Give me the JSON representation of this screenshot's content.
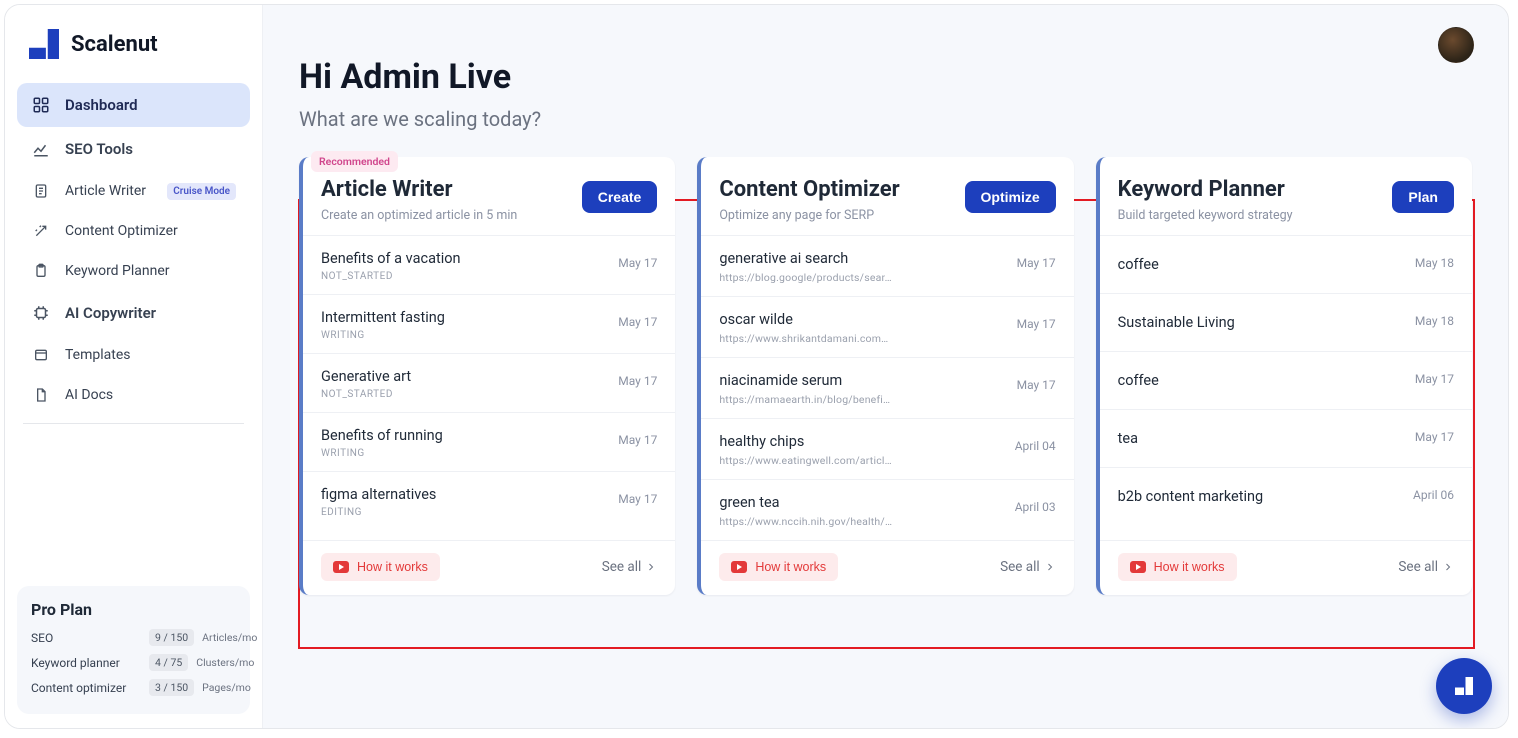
{
  "brand": {
    "name": "Scalenut"
  },
  "sidebar": {
    "items": [
      {
        "label": "Dashboard"
      },
      {
        "label": "SEO Tools"
      },
      {
        "label": "Article Writer",
        "badge": "Cruise Mode"
      },
      {
        "label": "Content Optimizer"
      },
      {
        "label": "Keyword Planner"
      },
      {
        "label": "AI Copywriter"
      },
      {
        "label": "Templates"
      },
      {
        "label": "AI Docs"
      }
    ],
    "plan": {
      "title": "Pro Plan",
      "rows": [
        {
          "label": "SEO",
          "used": "9 / 150",
          "unit": "Articles/mo"
        },
        {
          "label": "Keyword planner",
          "used": "4 / 75",
          "unit": "Clusters/mo"
        },
        {
          "label": "Content optimizer",
          "used": "3 / 150",
          "unit": "Pages/mo"
        }
      ]
    }
  },
  "header": {
    "greeting": "Hi Admin Live",
    "subtitle": "What are we scaling today?"
  },
  "cards": [
    {
      "recommended": "Recommended",
      "title": "Article Writer",
      "desc": "Create an optimized article in 5 min",
      "action": "Create",
      "items": [
        {
          "title": "Benefits of a vacation",
          "sub": "NOT_STARTED",
          "date": "May 17",
          "status": true
        },
        {
          "title": "Intermittent fasting",
          "sub": "WRITING",
          "date": "May 17",
          "status": true
        },
        {
          "title": "Generative art",
          "sub": "NOT_STARTED",
          "date": "May 17",
          "status": true
        },
        {
          "title": "Benefits of running",
          "sub": "WRITING",
          "date": "May 17",
          "status": true
        },
        {
          "title": "figma alternatives",
          "sub": "EDITING",
          "date": "May 17",
          "status": true
        }
      ],
      "how": "How it works",
      "seeall": "See all"
    },
    {
      "title": "Content Optimizer",
      "desc": "Optimize any page for SERP",
      "action": "Optimize",
      "items": [
        {
          "title": "generative ai search",
          "sub": "https://blog.google/products/sear…",
          "date": "May 17"
        },
        {
          "title": "oscar wilde",
          "sub": "https://www.shrikantdamani.com…",
          "date": "May 17"
        },
        {
          "title": "niacinamide serum",
          "sub": "https://mamaearth.in/blog/benefi…",
          "date": "May 17"
        },
        {
          "title": "healthy chips",
          "sub": "https://www.eatingwell.com/articl…",
          "date": "April 04"
        },
        {
          "title": "green tea",
          "sub": "https://www.nccih.nih.gov/health/…",
          "date": "April 03"
        }
      ],
      "how": "How it works",
      "seeall": "See all"
    },
    {
      "title": "Keyword Planner",
      "desc": "Build targeted keyword strategy",
      "action": "Plan",
      "items": [
        {
          "title": "coffee",
          "date": "May 18"
        },
        {
          "title": "Sustainable Living",
          "date": "May 18"
        },
        {
          "title": "coffee",
          "date": "May 17"
        },
        {
          "title": "tea",
          "date": "May 17"
        },
        {
          "title": "b2b content marketing",
          "date": "April 06"
        }
      ],
      "how": "How it works",
      "seeall": "See all"
    }
  ]
}
